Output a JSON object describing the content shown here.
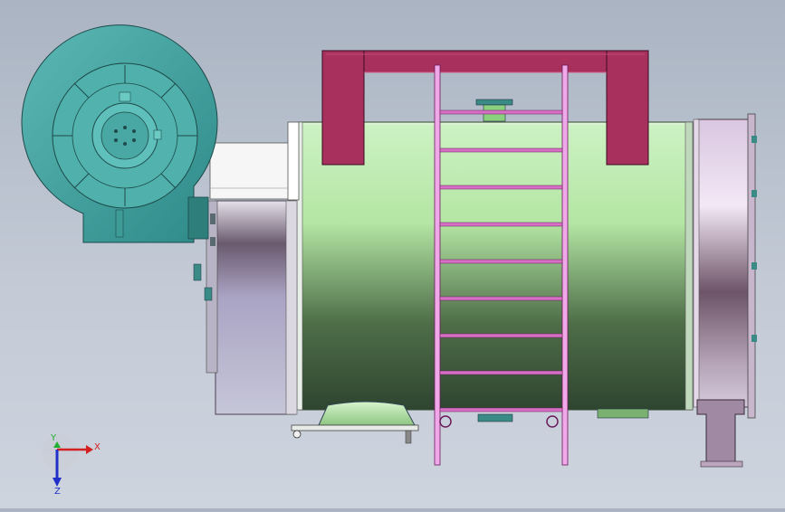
{
  "viewport": {
    "background_top": "#aab4c2",
    "background_bottom": "#ced4de"
  },
  "model": {
    "parts": [
      {
        "name": "centrifugal-fan",
        "color": "#4aa3a3"
      },
      {
        "name": "boiler-shell",
        "color": "#c6f0b8"
      },
      {
        "name": "lifting-frame",
        "color": "#a8305c"
      },
      {
        "name": "access-ladder",
        "color": "#e07ad0"
      },
      {
        "name": "rear-smokebox",
        "color": "#d9c7e2"
      },
      {
        "name": "burner-duct",
        "color": "#f4f4f4"
      },
      {
        "name": "support-saddle",
        "color": "#b4e8a8"
      },
      {
        "name": "support-leg",
        "color": "#a08aa3"
      }
    ]
  },
  "triad": {
    "x_label": "X",
    "y_label": "Y",
    "z_label": "Z",
    "x_color": "#d42020",
    "y_color": "#20b030",
    "z_color": "#2030c8"
  }
}
